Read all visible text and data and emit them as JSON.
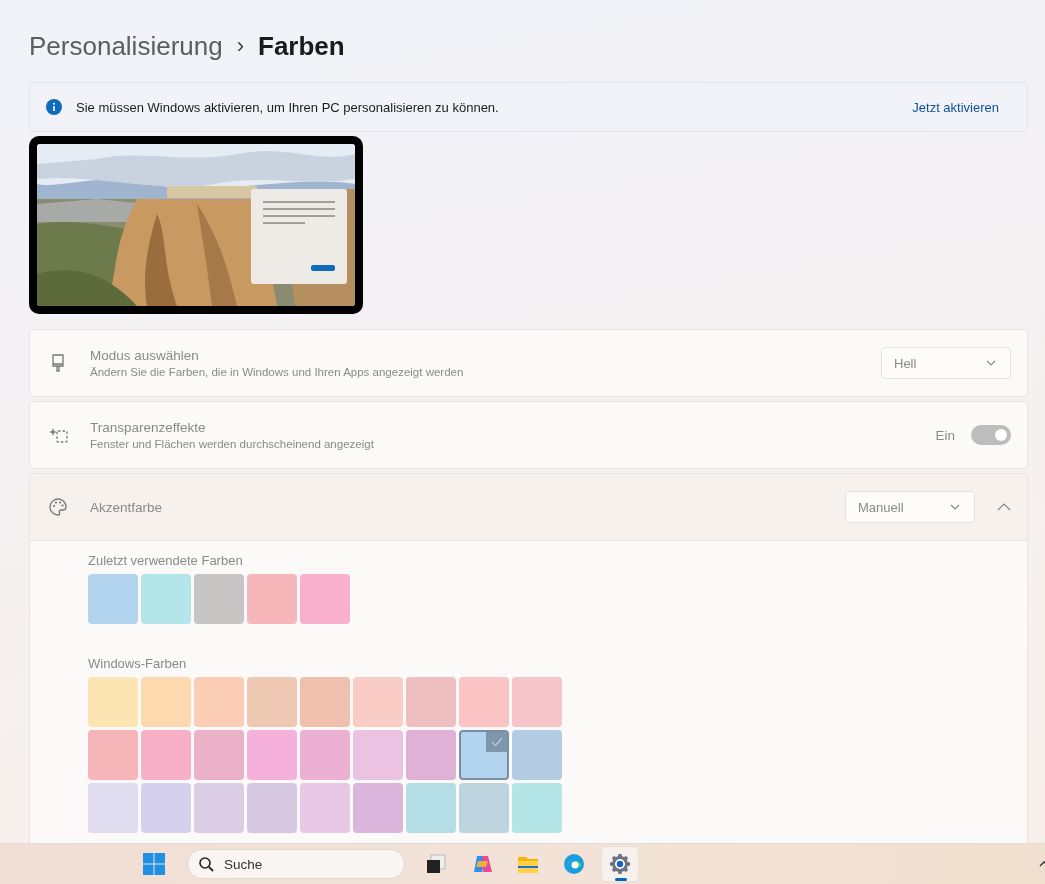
{
  "breadcrumb": {
    "parent": "Personalisierung",
    "separator": "›",
    "current": "Farben"
  },
  "banner": {
    "message": "Sie müssen Windows aktivieren, um Ihren PC personalisieren zu können.",
    "link": "Jetzt aktivieren"
  },
  "settings": [
    {
      "kind": "dropdown",
      "title": "Modus auswählen",
      "description": "Ändern Sie die Farben, die in Windows und Ihren Apps angezeigt werden",
      "value": "Hell",
      "disabled": true
    },
    {
      "kind": "toggle",
      "title": "Transparenzeffekte",
      "description": "Fenster und Flächen werden durchscheinend angezeigt",
      "value": "Ein",
      "on": true,
      "disabled": true
    },
    {
      "kind": "accent",
      "title": "Akzentfarbe",
      "value": "Manuell",
      "expanded": true,
      "disabled": true
    }
  ],
  "accent": {
    "recent_label": "Zuletzt verwendete Farben",
    "recent": [
      {
        "color": "#b3d4ef"
      },
      {
        "color": "#b4e5e8"
      },
      {
        "color": "#c6c5c3"
      },
      {
        "color": "#f7b6ba"
      },
      {
        "color": "#f8b0cb"
      }
    ],
    "windows_label": "Windows-Farben",
    "windows": [
      {
        "color": "#fde5b3",
        "selected": false
      },
      {
        "color": "#fcd9ae",
        "selected": false
      },
      {
        "color": "#fbcdb4",
        "selected": false
      },
      {
        "color": "#eec8b2",
        "selected": false
      },
      {
        "color": "#f0c0ae",
        "selected": false
      },
      {
        "color": "#f9ccc5",
        "selected": false
      },
      {
        "color": "#efbec0",
        "selected": false
      },
      {
        "color": "#fcc3c4",
        "selected": false
      },
      {
        "color": "#f6c5ca",
        "selected": false
      },
      {
        "color": "#f6b6b9",
        "selected": false
      },
      {
        "color": "#f8b0c9",
        "selected": false
      },
      {
        "color": "#ebb1c6",
        "selected": false
      },
      {
        "color": "#f5b1da",
        "selected": false
      },
      {
        "color": "#ebb0d2",
        "selected": false
      },
      {
        "color": "#ecc2e2",
        "selected": false
      },
      {
        "color": "#e0b1d7",
        "selected": false
      },
      {
        "color": "#b3d4ef",
        "selected": true
      },
      {
        "color": "#b3cce4",
        "selected": false
      },
      {
        "color": "#dfdcef",
        "selected": false
      },
      {
        "color": "#d6d0ef",
        "selected": false
      },
      {
        "color": "#dccde6",
        "selected": false
      },
      {
        "color": "#d6c7e0",
        "selected": false
      },
      {
        "color": "#e8c7e7",
        "selected": false
      },
      {
        "color": "#dbb5db",
        "selected": false
      },
      {
        "color": "#b4dde5",
        "selected": false
      },
      {
        "color": "#bdd4de",
        "selected": false
      },
      {
        "color": "#b4e5e7",
        "selected": false
      }
    ]
  },
  "taskbar": {
    "search_placeholder": "Suche",
    "apps": [
      {
        "kind": "taskview",
        "active": false
      },
      {
        "kind": "copilot",
        "active": false
      },
      {
        "kind": "explorer",
        "active": false
      },
      {
        "kind": "edge",
        "active": false
      },
      {
        "kind": "settings",
        "active": true
      }
    ]
  }
}
